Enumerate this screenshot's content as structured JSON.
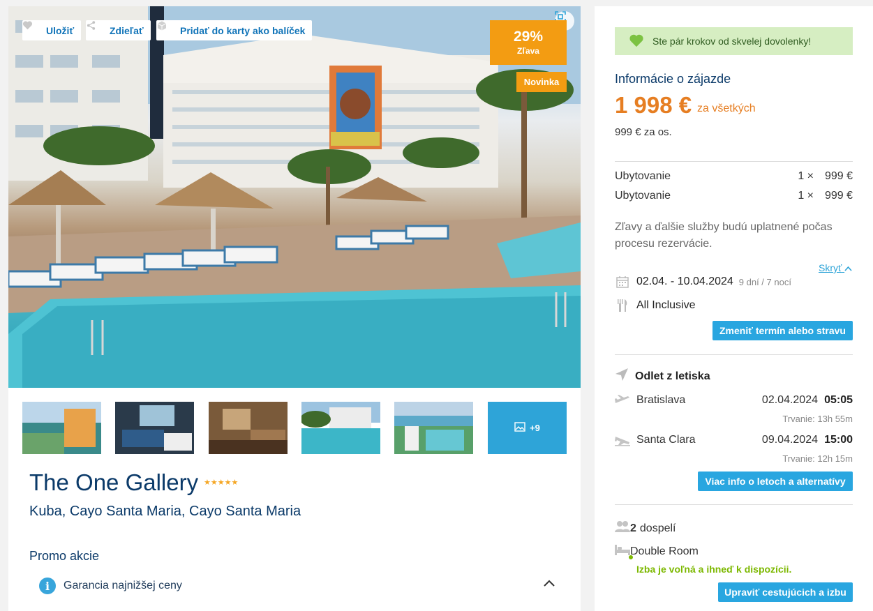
{
  "hero": {
    "actions": [
      {
        "label": "Uložiť",
        "icon": "heart-icon"
      },
      {
        "label": "Zdieľať",
        "icon": "share-icon"
      },
      {
        "label": "Pridať do karty ako balíček",
        "icon": "package-icon"
      }
    ],
    "discount_value": "29%",
    "discount_label": "Zľava",
    "new_badge": "Novinka",
    "more_photos": "+9"
  },
  "hotel": {
    "name": "The One Gallery",
    "stars": "★★★★★",
    "location": "Kuba, Cayo Santa Maria, Cayo Santa Maria"
  },
  "promo": {
    "title": "Promo akcie",
    "items": [
      {
        "label": "Garancia najnižšej ceny"
      }
    ]
  },
  "booking": {
    "banner": "Ste pár krokov od skvelej dovolenky!",
    "info_title": "Informácie o zájazde",
    "price_total": "1 998 €",
    "price_suffix": "za všetkých",
    "price_per_person": "999 € za os.",
    "lines": [
      {
        "label": "Ubytovanie",
        "qty": "1 ×",
        "amount": "999 €"
      },
      {
        "label": "Ubytovanie",
        "qty": "1 ×",
        "amount": "999 €"
      }
    ],
    "note": "Zľavy a ďalšie služby budú uplatnené počas procesu rezervácie.",
    "hide_link": "Skryť",
    "dates": "02.04. - 10.04.2024",
    "duration": "9 dní / 7 nocí",
    "board": "All Inclusive",
    "change_button": "Zmeniť termín alebo stravu",
    "flight_title": "Odlet z letiska",
    "flights": [
      {
        "city": "Bratislava",
        "date": "02.04.2024",
        "time": "05:05",
        "duration": "Trvanie: 13h 55m"
      },
      {
        "city": "Santa Clara",
        "date": "09.04.2024",
        "time": "15:00",
        "duration": "Trvanie: 12h 15m"
      }
    ],
    "flights_button": "Viac info o letoch a alternatívy",
    "pax_count": "2",
    "pax_label": "dospelí",
    "room": "Double Room",
    "availability": "Izba je voľná a ihneď k dispozícii.",
    "edit_button": "Upraviť cestujúcich a izbu"
  },
  "colors": {
    "accent_blue": "#29a6e0",
    "title_navy": "#0b3a69",
    "price_orange": "#e67e22",
    "badge_orange": "#f39c12",
    "available_green": "#7cb800"
  }
}
